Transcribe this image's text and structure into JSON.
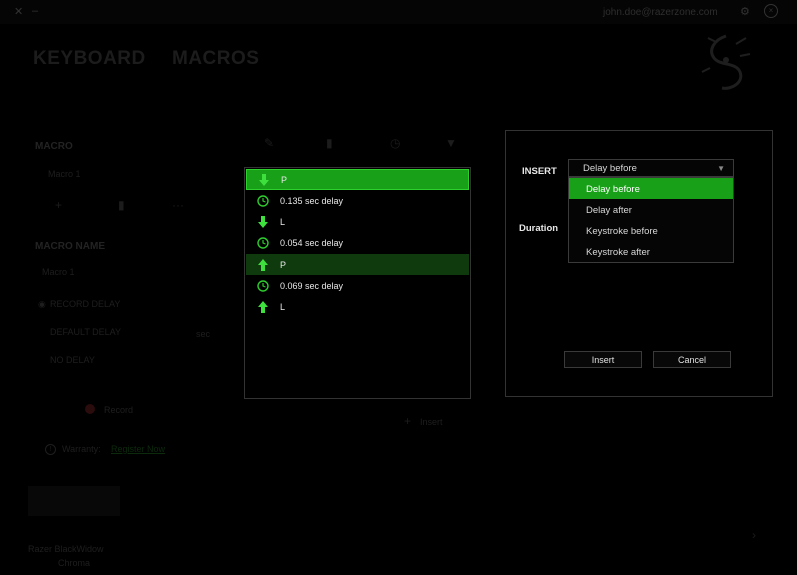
{
  "window": {
    "email": "john.doe@razerzone.com"
  },
  "nav": {
    "tab_keyboard": "KEYBOARD",
    "tab_macros": "MACROS"
  },
  "left": {
    "macro_heading": "MACRO",
    "macro_item": "Macro 1",
    "macro_name_heading": "MACRO NAME",
    "macro_name_value": "Macro 1",
    "record_delay": "RECORD DELAY",
    "default_delay": "DEFAULT DELAY",
    "default_delay_unit": "sec",
    "no_delay": "NO DELAY",
    "record": "Record",
    "warranty_label": "Warranty:",
    "warranty_link": "Register Now",
    "footer_left": "Razer Synapse",
    "footer_sub": "Razer BlackWidow",
    "footer_sub2": "Chroma"
  },
  "events": [
    {
      "icon": "key-down-arrow-icon",
      "label": "P",
      "state": "selected"
    },
    {
      "icon": "clock-icon",
      "label": "0.135 sec delay",
      "state": "normal"
    },
    {
      "icon": "key-down-arrow-icon",
      "label": "L",
      "state": "normal"
    },
    {
      "icon": "clock-icon",
      "label": "0.054 sec delay",
      "state": "normal"
    },
    {
      "icon": "key-up-arrow-icon",
      "label": "P",
      "state": "highlight"
    },
    {
      "icon": "clock-icon",
      "label": "0.069 sec delay",
      "state": "normal"
    },
    {
      "icon": "key-up-arrow-icon",
      "label": "L",
      "state": "normal"
    }
  ],
  "insert_dialog": {
    "insert_label": "INSERT",
    "duration_label": "Duration",
    "selected": "Delay before",
    "options": [
      "Delay before",
      "Delay after",
      "Keystroke before",
      "Keystroke after"
    ],
    "insert_button": "Insert",
    "cancel_button": "Cancel"
  },
  "below_panel": {
    "insert": "Insert"
  },
  "colors": {
    "accent": "#18a018",
    "highlight_row": "#0e3a0e",
    "background": "#000000"
  }
}
